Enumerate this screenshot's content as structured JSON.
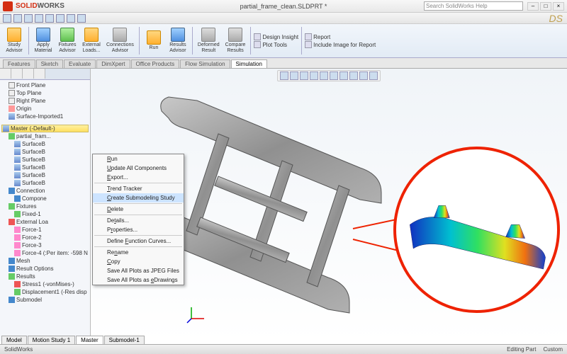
{
  "brand": {
    "solid": "SOLID",
    "works": "WORKS"
  },
  "title_file": "partial_frame_clean.SLDPRT *",
  "search_placeholder": "Search SolidWorks Help",
  "ribbon": {
    "study_advisor": "Study\nAdvisor",
    "apply_material": "Apply\nMaterial",
    "fixtures_advisor": "Fixtures\nAdvisor",
    "external_loads": "External\nLoads...",
    "connections_advisor": "Connections\nAdvisor",
    "run": "Run",
    "results_advisor": "Results\nAdvisor",
    "deformed_result": "Deformed\nResult",
    "compare_results": "Compare\nResults",
    "design_insight": "Design Insight",
    "plot_tools": "Plot Tools",
    "report": "Report",
    "include_image": "Include Image for Report"
  },
  "doc_tabs": [
    "Features",
    "Sketch",
    "Evaluate",
    "DimXpert",
    "Office Products",
    "Flow Simulation",
    "Simulation"
  ],
  "doc_tab_active": 6,
  "tree": {
    "planes": [
      "Front Plane",
      "Top Plane",
      "Right Plane"
    ],
    "origin": "Origin",
    "surface_imported": "Surface-Imported1",
    "study_header": "Master (-Default-)",
    "part_node": "partial_fram...",
    "surface_bodies": [
      "SurfaceB",
      "SurfaceB",
      "SurfaceB",
      "SurfaceB",
      "SurfaceB",
      "SurfaceB"
    ],
    "connections": "Connection",
    "component": "Compone",
    "fixtures": "Fixtures",
    "fixed": "Fixed-1",
    "external_loads": "External Loa",
    "forces": [
      "Force-1",
      "Force-2",
      "Force-3"
    ],
    "force4": "Force-4 (:Per item: -598 N",
    "mesh": "Mesh",
    "result_options": "Result Options",
    "results": "Results",
    "stress": "Stress1 (-vonMises-)",
    "displacement": "Displacement1 (-Res disp",
    "submodel": "Submodel"
  },
  "context_menu": [
    {
      "label": "Run",
      "u": 0
    },
    {
      "label": "Update All Components",
      "u": 0
    },
    {
      "label": "Export...",
      "u": 0
    },
    {
      "sep": true
    },
    {
      "label": "Trend Tracker",
      "u": 0
    },
    {
      "label": "Create Submodeling Study",
      "u": 0,
      "hl": true
    },
    {
      "sep": true
    },
    {
      "label": "Delete",
      "u": 0
    },
    {
      "sep": true
    },
    {
      "label": "Details...",
      "u": 2
    },
    {
      "label": "Properties...",
      "u": 1
    },
    {
      "sep": true
    },
    {
      "label": "Define Function Curves...",
      "u": 7
    },
    {
      "sep": true
    },
    {
      "label": "Rename",
      "u": 2
    },
    {
      "label": "Copy",
      "u": 0
    },
    {
      "label": "Save All Plots as JPEG Files"
    },
    {
      "label": "Save All Plots as eDrawings",
      "u": 18
    }
  ],
  "bottom_tabs": {
    "model": "Model",
    "motion": "Motion Study 1",
    "master": "Master",
    "submodel": "Submodel-1"
  },
  "status": {
    "left": "SolidWorks",
    "mid": "Editing Part",
    "right": "Custom"
  }
}
